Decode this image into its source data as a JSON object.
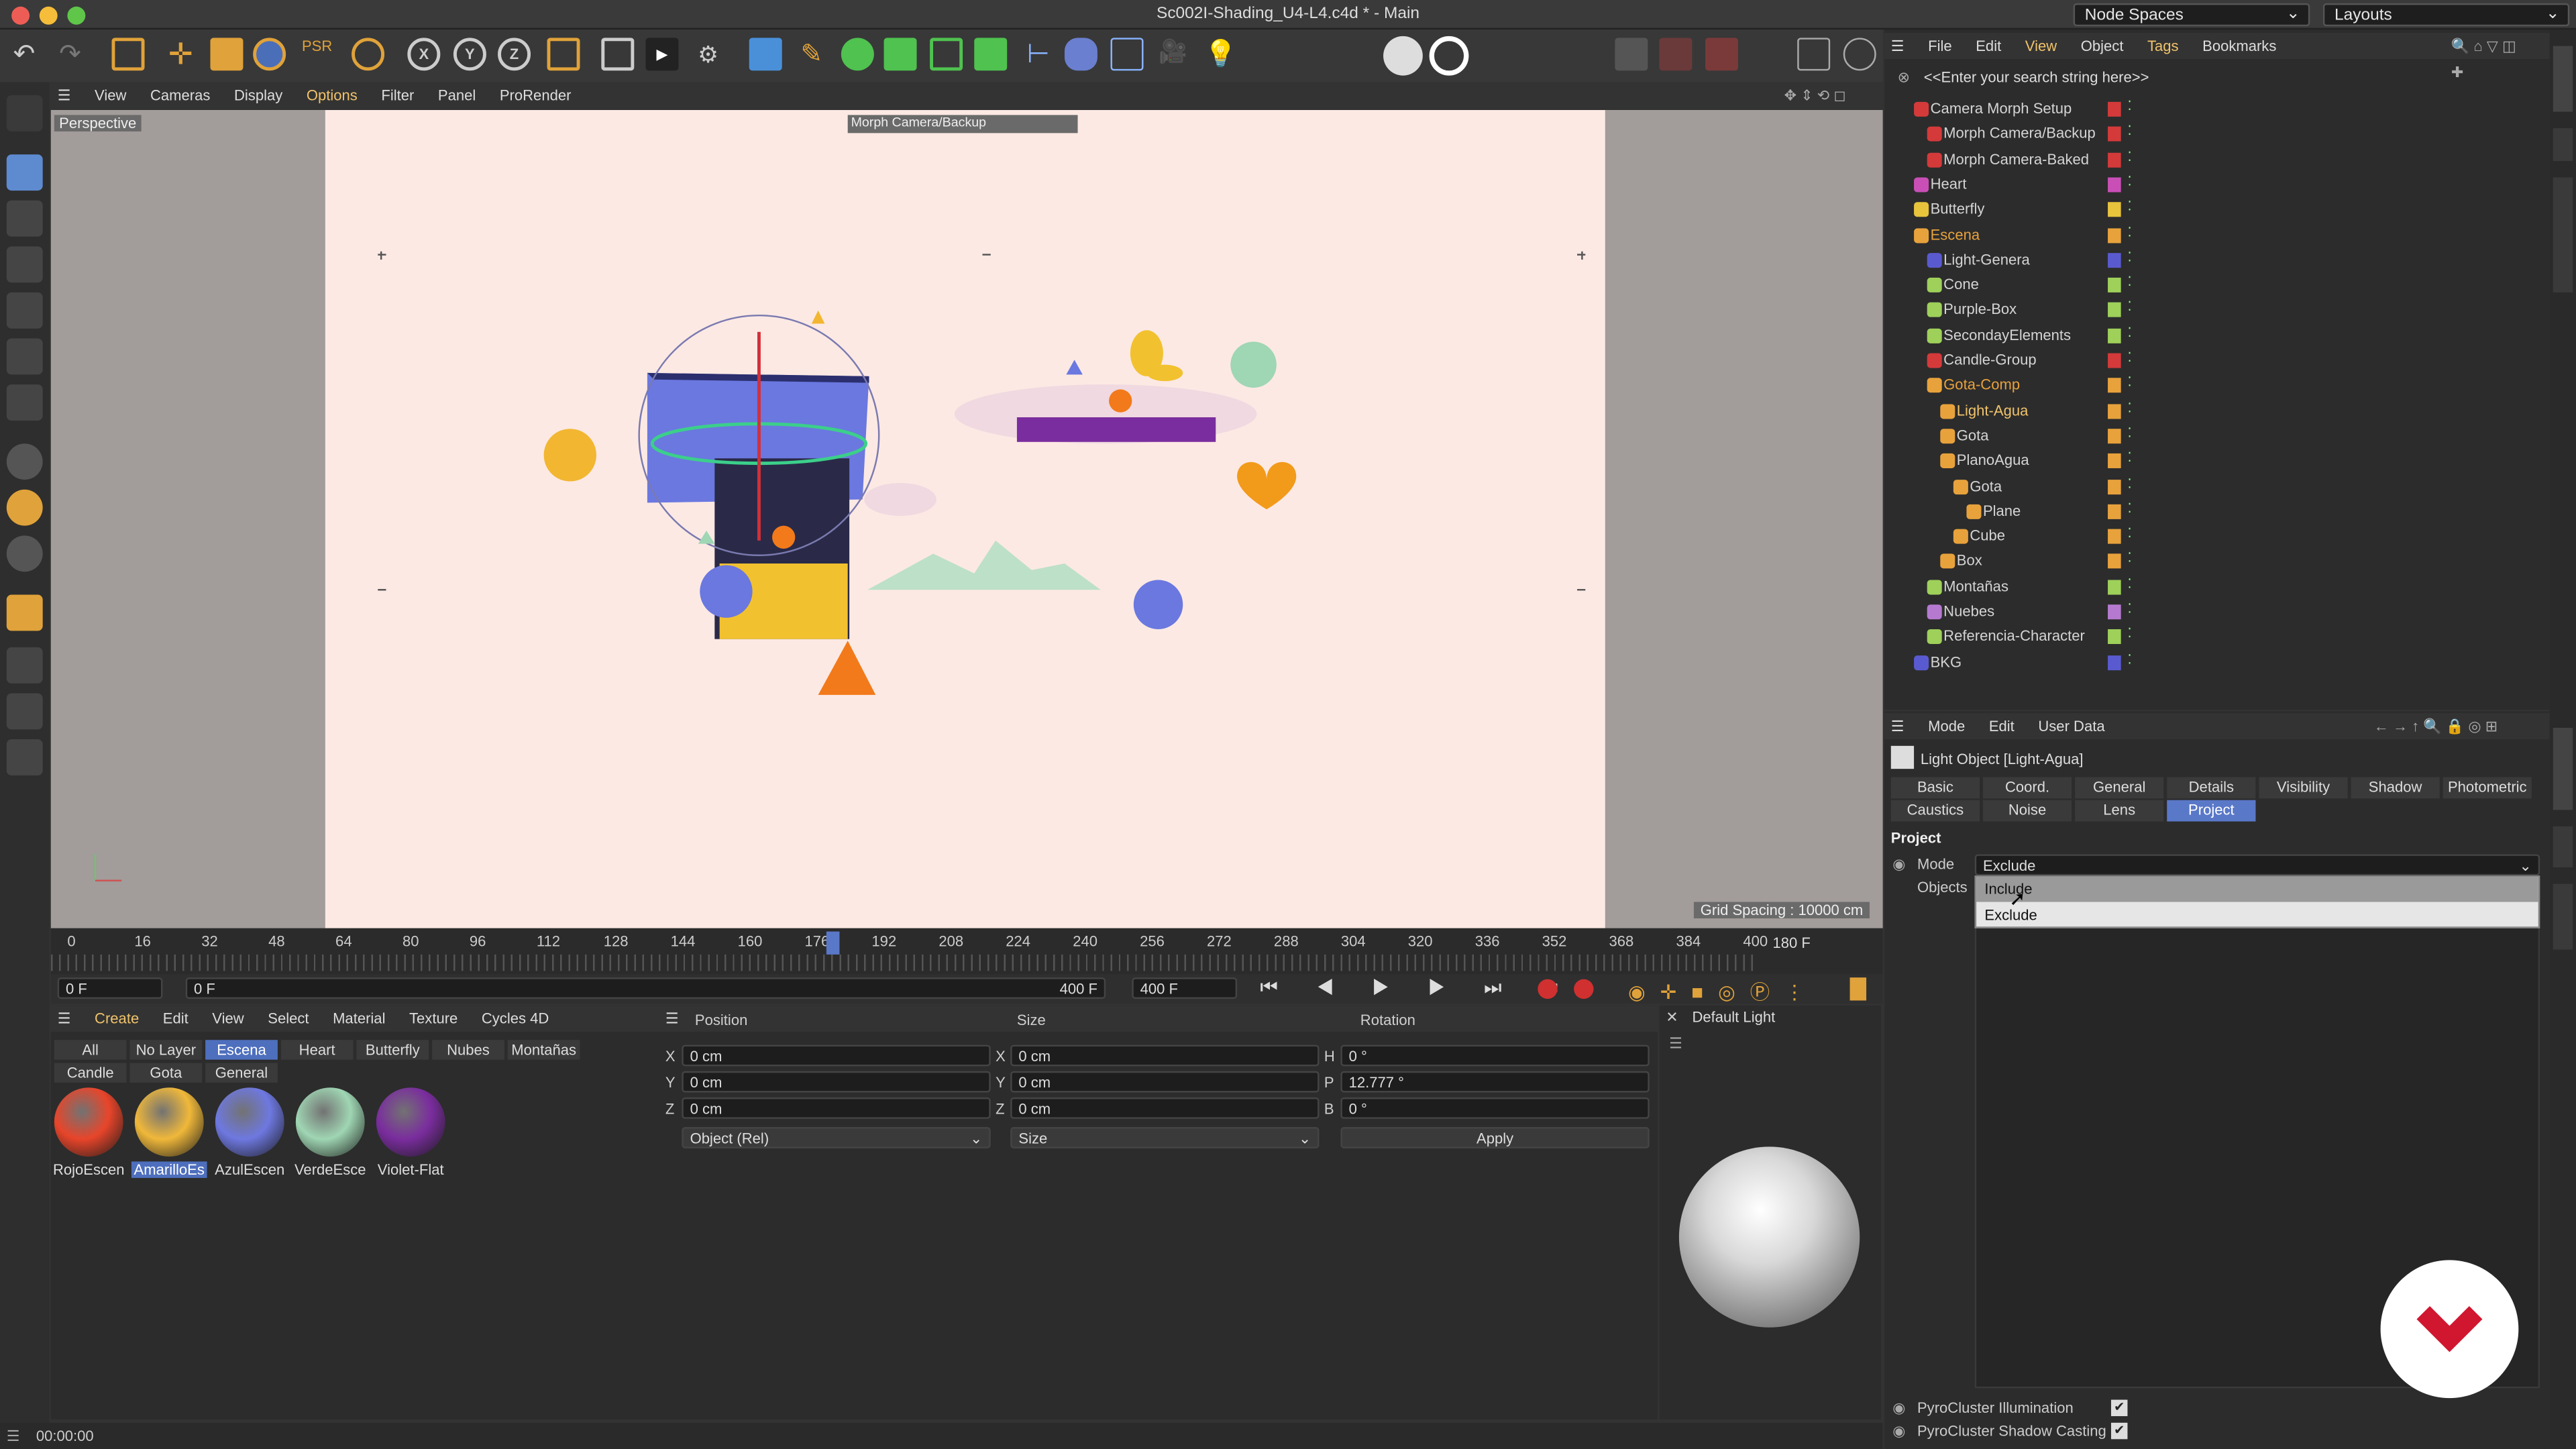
{
  "window": {
    "title": "Sc002I-Shading_U4-L4.c4d * - Main",
    "node_spaces": "Node Spaces",
    "layouts": "Layouts"
  },
  "viewport": {
    "menu": [
      "View",
      "Cameras",
      "Display",
      "Options",
      "Filter",
      "Panel",
      "ProRender"
    ],
    "label": "Perspective",
    "camera_label": "Morph Camera/Backup",
    "grid_spacing": "Grid Spacing : 10000 cm"
  },
  "timeline": {
    "ticks": [
      "0",
      "16",
      "32",
      "48",
      "64",
      "80",
      "96",
      "112",
      "128",
      "144",
      "160",
      "176",
      "192",
      "208",
      "224",
      "240",
      "256",
      "272",
      "288",
      "304",
      "320",
      "336",
      "352",
      "368",
      "384",
      "400"
    ],
    "playhead": "180",
    "end_frame": "180 F",
    "start_field": "0 F",
    "range_start": "0 F",
    "range_end": "400 F",
    "max_field": "400 F"
  },
  "objects_menu": [
    "File",
    "Edit",
    "View",
    "Object",
    "Tags",
    "Bookmarks"
  ],
  "search_placeholder": "<<Enter your search string here>>",
  "objects": [
    {
      "name": "Camera Morph Setup",
      "color": "#d43a3a"
    },
    {
      "name": "Morph Camera/Backup",
      "color": "#d43a3a"
    },
    {
      "name": "Morph Camera-Baked",
      "color": "#d43a3a"
    },
    {
      "name": "Heart",
      "color": "#c94fb6"
    },
    {
      "name": "Butterfly",
      "color": "#e8c33c"
    },
    {
      "name": "Escena",
      "color": "#e8a23c"
    },
    {
      "name": "Light-Genera",
      "color": "#5a5ad0"
    },
    {
      "name": "Cone",
      "color": "#9ed05a"
    },
    {
      "name": "Purple-Box",
      "color": "#9ed05a"
    },
    {
      "name": "SecondayElements",
      "color": "#9ed05a"
    },
    {
      "name": "Candle-Group",
      "color": "#d43a3a"
    },
    {
      "name": "Gota-Comp",
      "color": "#e8a23c"
    },
    {
      "name": "Light-Agua",
      "color": "#e8a23c"
    },
    {
      "name": "Gota",
      "color": "#e8a23c"
    },
    {
      "name": "PlanoAgua",
      "color": "#e8a23c"
    },
    {
      "name": "Gota",
      "color": "#e8a23c"
    },
    {
      "name": "Plane",
      "color": "#e8a23c"
    },
    {
      "name": "Cube",
      "color": "#e8a23c"
    },
    {
      "name": "Box",
      "color": "#e8a23c"
    },
    {
      "name": "Montañas",
      "color": "#9ed05a"
    },
    {
      "name": "Nuebes",
      "color": "#b57ad0"
    },
    {
      "name": "Referencia-Character",
      "color": "#9ed05a"
    },
    {
      "name": "BKG",
      "color": "#5a5ad0"
    }
  ],
  "attributes": {
    "menu": [
      "Mode",
      "Edit",
      "User Data"
    ],
    "object_title": "Light Object [Light-Agua]",
    "tabs_row1": [
      "Basic",
      "Coord.",
      "General",
      "Details",
      "Visibility",
      "Shadow",
      "Photometric"
    ],
    "tabs_row2": [
      "Caustics",
      "Noise",
      "Lens",
      "Project"
    ],
    "selected_tab": "Project",
    "section": "Project",
    "mode_label": "Mode",
    "mode_value": "Exclude",
    "objects_label": "Objects",
    "dropdown_options": [
      "Include",
      "Exclude"
    ],
    "pyro1": "PyroCluster Illumination",
    "pyro2": "PyroCluster Shadow Casting"
  },
  "materials": {
    "menu": [
      "Create",
      "Edit",
      "View",
      "Select",
      "Material",
      "Texture",
      "Cycles 4D"
    ],
    "filters_row1": [
      "All",
      "No Layer",
      "Escena",
      "Heart",
      "Butterfly",
      "Nubes",
      "Montañas"
    ],
    "filters_row2": [
      "Candle",
      "Gota",
      "General"
    ],
    "selected_filter": "Escena",
    "items": [
      {
        "name": "RojoEscen",
        "color": "#e8452a"
      },
      {
        "name": "AmarilloEs",
        "color": "#f0b83a"
      },
      {
        "name": "AzulEscen",
        "color": "#6e78e0"
      },
      {
        "name": "VerdeEsce",
        "color": "#9fd6b3"
      },
      {
        "name": "Violet-Flat",
        "color": "#7a2d9e"
      }
    ]
  },
  "coords": {
    "headers": [
      "Position",
      "Size",
      "Rotation"
    ],
    "pos": {
      "x": "0 cm",
      "y": "0 cm",
      "z": "0 cm"
    },
    "size": {
      "x": "0 cm",
      "y": "0 cm",
      "z": "0 cm"
    },
    "rot": {
      "h": "0 °",
      "p": "12.777 °",
      "b": "0 °"
    },
    "mode_select": "Object (Rel)",
    "size_select": "Size",
    "apply": "Apply"
  },
  "preview": {
    "title": "Default Light"
  },
  "status": {
    "time": "00:00:00"
  }
}
